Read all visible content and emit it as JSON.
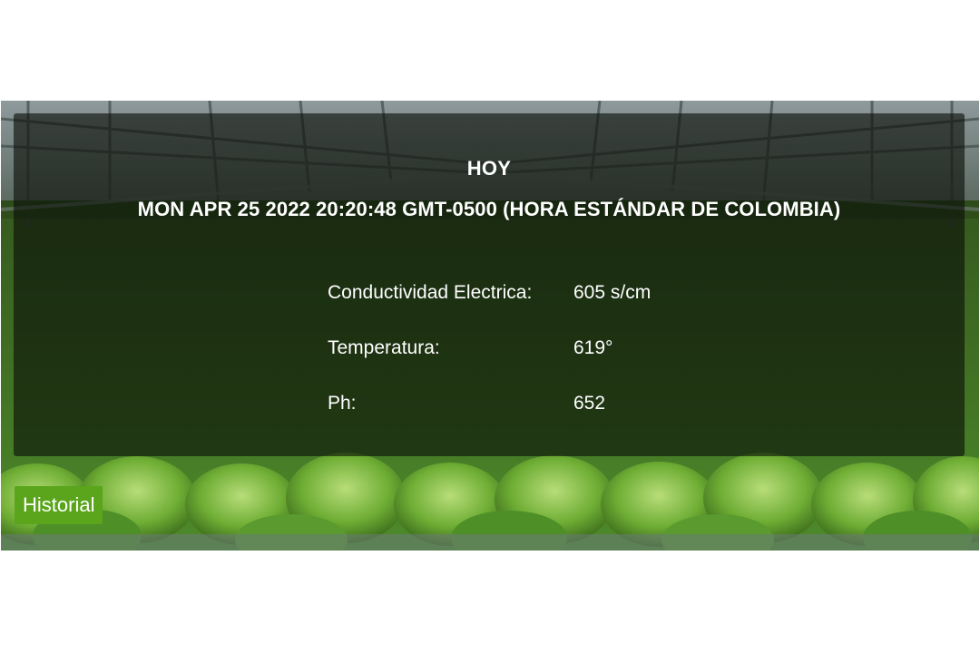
{
  "panel": {
    "title": "HOY",
    "datetime": "Mon Apr 25 2022 20:20:48 GMT-0500 (hora estándar de Colombia)"
  },
  "readings": [
    {
      "label": "Conductividad Electrica:",
      "value": "605 s/cm"
    },
    {
      "label": "Temperatura:",
      "value": "619°"
    },
    {
      "label": "Ph:",
      "value": "652"
    }
  ],
  "history_button": {
    "label": "Historial"
  },
  "colors": {
    "button": "#5aa51c",
    "panel_overlay": "rgba(10,14,8,0.62)",
    "text": "#ffffff"
  },
  "background_image": {
    "icon": "greenhouse-lettuce-photo"
  }
}
